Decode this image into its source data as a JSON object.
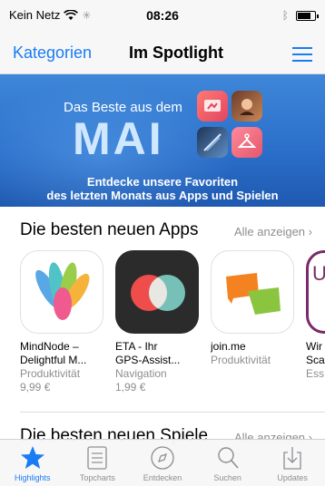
{
  "status_bar": {
    "carrier": "Kein Netz",
    "time": "08:26",
    "battery_level": 0.75
  },
  "nav": {
    "back_label": "Kategorien",
    "title": "Im Spotlight"
  },
  "banner": {
    "pre_title": "Das Beste aus dem",
    "big_title": "MAI",
    "subtitle_line1": "Entdecke unsere Favoriten",
    "subtitle_line2": "des letzten Monats aus Apps und Spielen"
  },
  "section_apps": {
    "title": "Die besten neuen Apps",
    "more_label": "Alle anzeigen",
    "apps": [
      {
        "name_line1": "MindNode –",
        "name_line2": "Delightful M...",
        "category": "Produktivität",
        "price": "9,99 €",
        "icon": "mindnode-icon"
      },
      {
        "name_line1": "ETA - Ihr",
        "name_line2": "GPS-Assist...",
        "category": "Navigation",
        "price": "1,99 €",
        "icon": "eta-icon"
      },
      {
        "name_line1": "join.me",
        "name_line2": "",
        "category": "Produktivität",
        "price": "",
        "icon": "joinme-icon"
      },
      {
        "name_line1": "Wir",
        "name_line2": "Sca",
        "category": "Ess",
        "price": "",
        "icon": "partial-app-icon"
      }
    ]
  },
  "section_games": {
    "title": "Die besten neuen Spiele",
    "more_label": "Alle anzeigen"
  },
  "tabs": [
    {
      "label": "Highlights",
      "icon": "star-icon",
      "active": true
    },
    {
      "label": "Topcharts",
      "icon": "list-icon",
      "active": false
    },
    {
      "label": "Entdecken",
      "icon": "compass-icon",
      "active": false
    },
    {
      "label": "Suchen",
      "icon": "search-icon",
      "active": false
    },
    {
      "label": "Updates",
      "icon": "download-icon",
      "active": false
    }
  ],
  "colors": {
    "accent": "#1a7cf5",
    "banner": "#2a6ec9",
    "secondary_text": "#8e8e93"
  }
}
